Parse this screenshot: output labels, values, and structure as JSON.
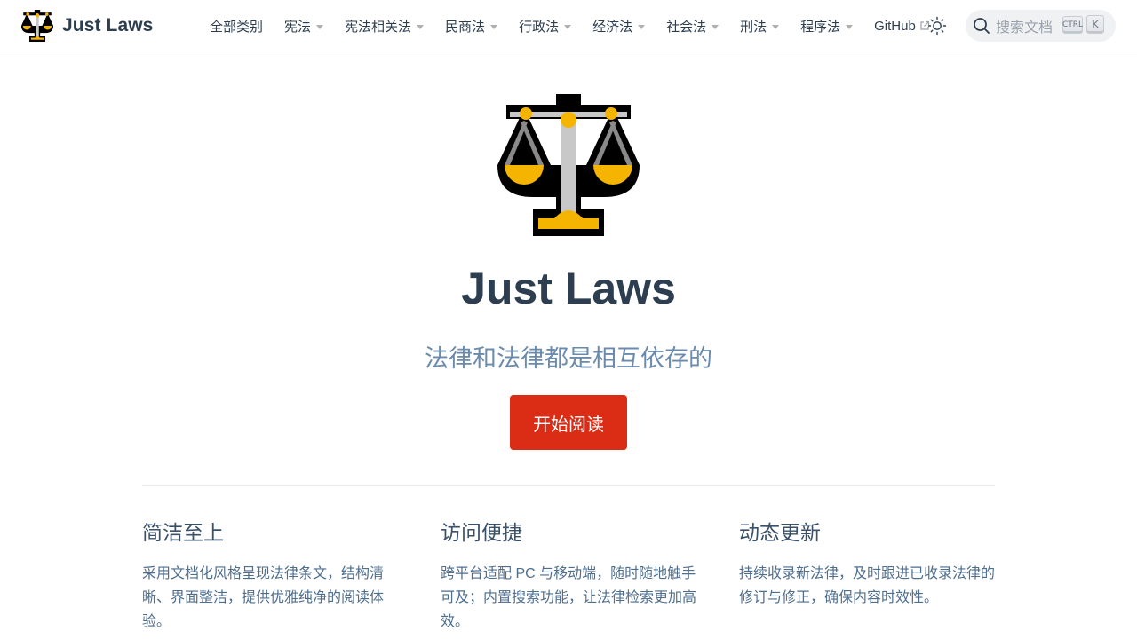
{
  "brand": {
    "title": "Just Laws"
  },
  "nav": {
    "items": [
      {
        "label": "全部类别",
        "dropdown": false
      },
      {
        "label": "宪法",
        "dropdown": true
      },
      {
        "label": "宪法相关法",
        "dropdown": true
      },
      {
        "label": "民商法",
        "dropdown": true
      },
      {
        "label": "行政法",
        "dropdown": true
      },
      {
        "label": "经济法",
        "dropdown": true
      },
      {
        "label": "社会法",
        "dropdown": true
      },
      {
        "label": "刑法",
        "dropdown": true
      },
      {
        "label": "程序法",
        "dropdown": true
      }
    ],
    "github_label": "GitHub"
  },
  "search": {
    "placeholder": "搜索文档",
    "kbd_ctrl": "CTRL",
    "kbd_k": "K"
  },
  "hero": {
    "title": "Just Laws",
    "tagline": "法律和法律都是相互依存的",
    "action_label": "开始阅读"
  },
  "features": [
    {
      "title": "简洁至上",
      "desc": "采用文档化风格呈现法律条文，结构清晰、界面整洁，提供优雅纯净的阅读体验。"
    },
    {
      "title": "访问便捷",
      "desc": "跨平台适配 PC 与移动端，随时随地触手可及；内置搜索功能，让法律检索更加高效。"
    },
    {
      "title": "动态更新",
      "desc": "持续收录新法律，及时跟进已收录法律的修订与修正，确保内容时效性。"
    }
  ],
  "colors": {
    "accent": "#db2c15",
    "text": "#2c3e50",
    "tagline": "#6a8bad",
    "logo_gold": "#f5b400"
  },
  "icons": {
    "logo": "balance-scale-icon",
    "theme": "sun-icon",
    "search": "search-icon",
    "external": "external-link-icon"
  }
}
